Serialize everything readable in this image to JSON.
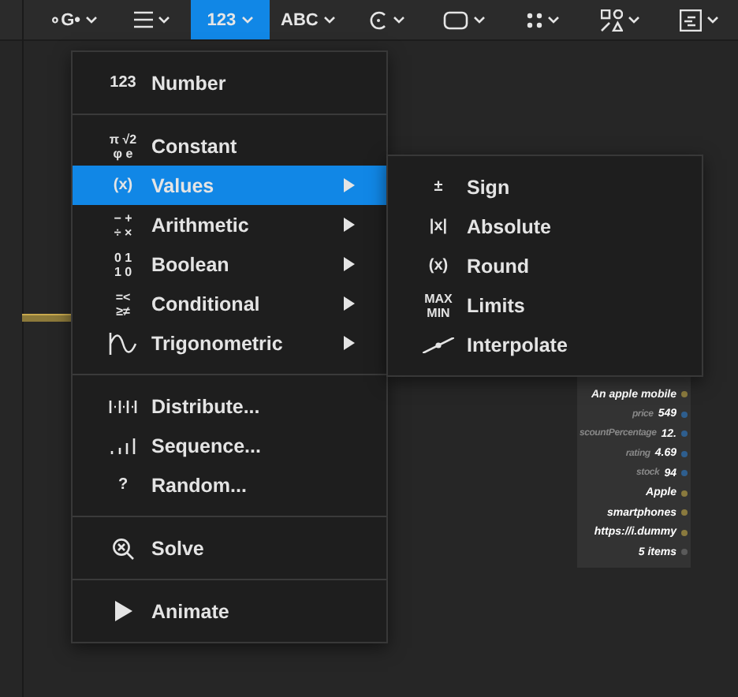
{
  "toolbar": [
    {
      "label": "∘G•",
      "selected": false
    },
    {
      "selected": false
    },
    {
      "label": "123",
      "selected": true
    },
    {
      "label": "ABC",
      "selected": false
    },
    {
      "selected": false
    },
    {
      "selected": false
    },
    {
      "selected": false
    },
    {
      "selected": false
    },
    {
      "selected": false
    }
  ],
  "menu": {
    "sections": [
      [
        {
          "glyph": [
            "123"
          ],
          "label": "Number",
          "selected": false,
          "submenu": false
        }
      ],
      [
        {
          "glyph": [
            "π √2",
            "φ e"
          ],
          "label": "Constant",
          "selected": false,
          "submenu": false
        },
        {
          "glyph": [
            "(x)"
          ],
          "label": "Values",
          "selected": true,
          "submenu": true
        },
        {
          "glyph": [
            "− +",
            "÷ ×"
          ],
          "label": "Arithmetic",
          "selected": false,
          "submenu": true
        },
        {
          "glyph": [
            "0 1",
            "1 0"
          ],
          "label": "Boolean",
          "selected": false,
          "submenu": true
        },
        {
          "glyph": [
            "=<",
            "≥≠"
          ],
          "label": "Conditional",
          "selected": false,
          "submenu": true
        },
        {
          "label": "Trigonometric",
          "selected": false,
          "submenu": true
        }
      ],
      [
        {
          "label": "Distribute...",
          "selected": false,
          "submenu": false
        },
        {
          "label": "Sequence...",
          "selected": false,
          "submenu": false
        },
        {
          "glyph": [
            "?"
          ],
          "label": "Random...",
          "selected": false,
          "submenu": false
        }
      ],
      [
        {
          "label": "Solve",
          "selected": false,
          "submenu": false
        }
      ],
      [
        {
          "label": "Animate",
          "selected": false,
          "submenu": false
        }
      ]
    ]
  },
  "submenu": {
    "items": [
      {
        "glyph": [
          "±"
        ],
        "label": "Sign"
      },
      {
        "glyph": [
          "|x|"
        ],
        "label": "Absolute"
      },
      {
        "glyph": [
          "(x)"
        ],
        "label": "Round"
      },
      {
        "glyph": [
          "MAX",
          "MIN"
        ],
        "label": "Limits"
      },
      {
        "label": "Interpolate"
      }
    ]
  },
  "node": {
    "rows": [
      {
        "value": "An apple mobile",
        "color": "#8a7a3e"
      },
      {
        "key": "price",
        "value": "549",
        "color": "#2e5e8e"
      },
      {
        "key": "scountPercentage",
        "value": "12.",
        "color": "#2e5e8e"
      },
      {
        "key": "rating",
        "value": "4.69",
        "color": "#2e5e8e"
      },
      {
        "key": "stock",
        "value": "94",
        "color": "#2e5e8e"
      },
      {
        "value": "Apple",
        "color": "#8a7a3e"
      },
      {
        "value": "smartphones",
        "color": "#8a7a3e"
      },
      {
        "value": "https://i.dummy",
        "color": "#8a7a3e"
      },
      {
        "value": "5 items",
        "color": "#5a5a5a"
      }
    ]
  }
}
